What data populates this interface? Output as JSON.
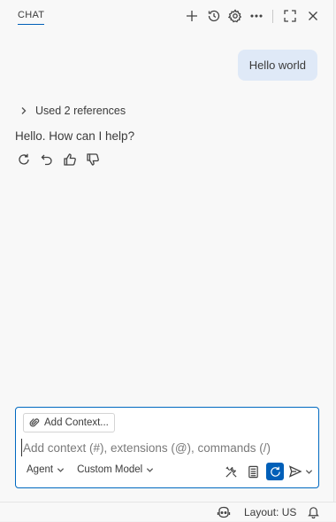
{
  "header": {
    "tab_label": "CHAT",
    "icons": [
      "plus-icon",
      "history-icon",
      "gear-icon",
      "more-icon",
      "maximize-icon",
      "close-icon"
    ]
  },
  "conversation": {
    "user_message": "Hello world",
    "references_label": "Used 2 references",
    "assistant_reply": "Hello. How can I help?",
    "actions": [
      "retry-icon",
      "undo-icon",
      "thumbs-up-icon",
      "thumbs-down-icon"
    ]
  },
  "composer": {
    "add_context_label": "Add Context...",
    "placeholder": "Add context (#), extensions (@), commands (/)",
    "value": "",
    "mode_label": "Agent",
    "model_label": "Custom Model",
    "tools": [
      "tools-icon",
      "calculator-icon",
      "refresh-icon",
      "send-icon"
    ]
  },
  "statusbar": {
    "layout_label": "Layout: US"
  },
  "colors": {
    "accent": "#005fb8",
    "user_bubble": "#dfe9f7",
    "panel_bg": "#f8f8f8"
  }
}
